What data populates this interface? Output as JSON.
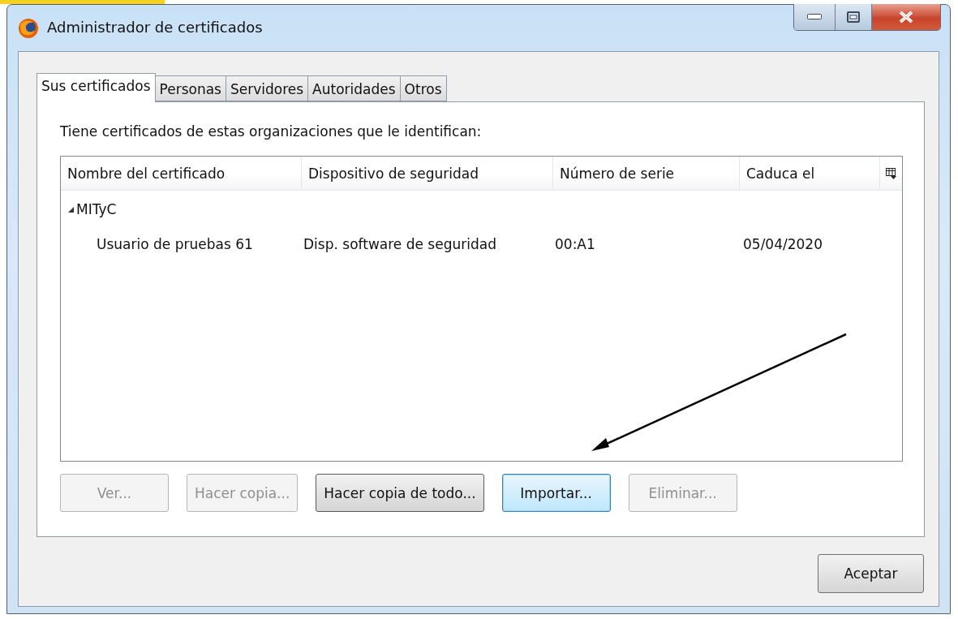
{
  "window": {
    "title": "Administrador de certificados"
  },
  "tabs": [
    {
      "label": "Sus certificados",
      "selected": true
    },
    {
      "label": "Personas",
      "selected": false
    },
    {
      "label": "Servidores",
      "selected": false
    },
    {
      "label": "Autoridades",
      "selected": false
    },
    {
      "label": "Otros",
      "selected": false
    }
  ],
  "description": "Tiene certificados de estas organizaciones que le identifican:",
  "table": {
    "columns": [
      "Nombre del certificado",
      "Dispositivo de seguridad",
      "Número de serie",
      "Caduca el"
    ],
    "rows": [
      {
        "name": "MITyC",
        "expanded": true,
        "children": [
          {
            "cells": [
              "Usuario de pruebas 61",
              "Disp. software de seguridad",
              "00:A1",
              "05/04/2020"
            ]
          }
        ]
      }
    ]
  },
  "buttons": [
    {
      "label": "Ver...",
      "disabled": true,
      "focused": false,
      "default": false
    },
    {
      "label": "Hacer copia...",
      "disabled": true,
      "focused": false,
      "default": false
    },
    {
      "label": "Hacer copia de todo...",
      "disabled": false,
      "focused": false,
      "default": true
    },
    {
      "label": "Importar...",
      "disabled": false,
      "focused": true,
      "default": false
    },
    {
      "label": "Eliminar...",
      "disabled": true,
      "focused": false,
      "default": false
    }
  ],
  "ok_button": {
    "label": "Aceptar"
  }
}
